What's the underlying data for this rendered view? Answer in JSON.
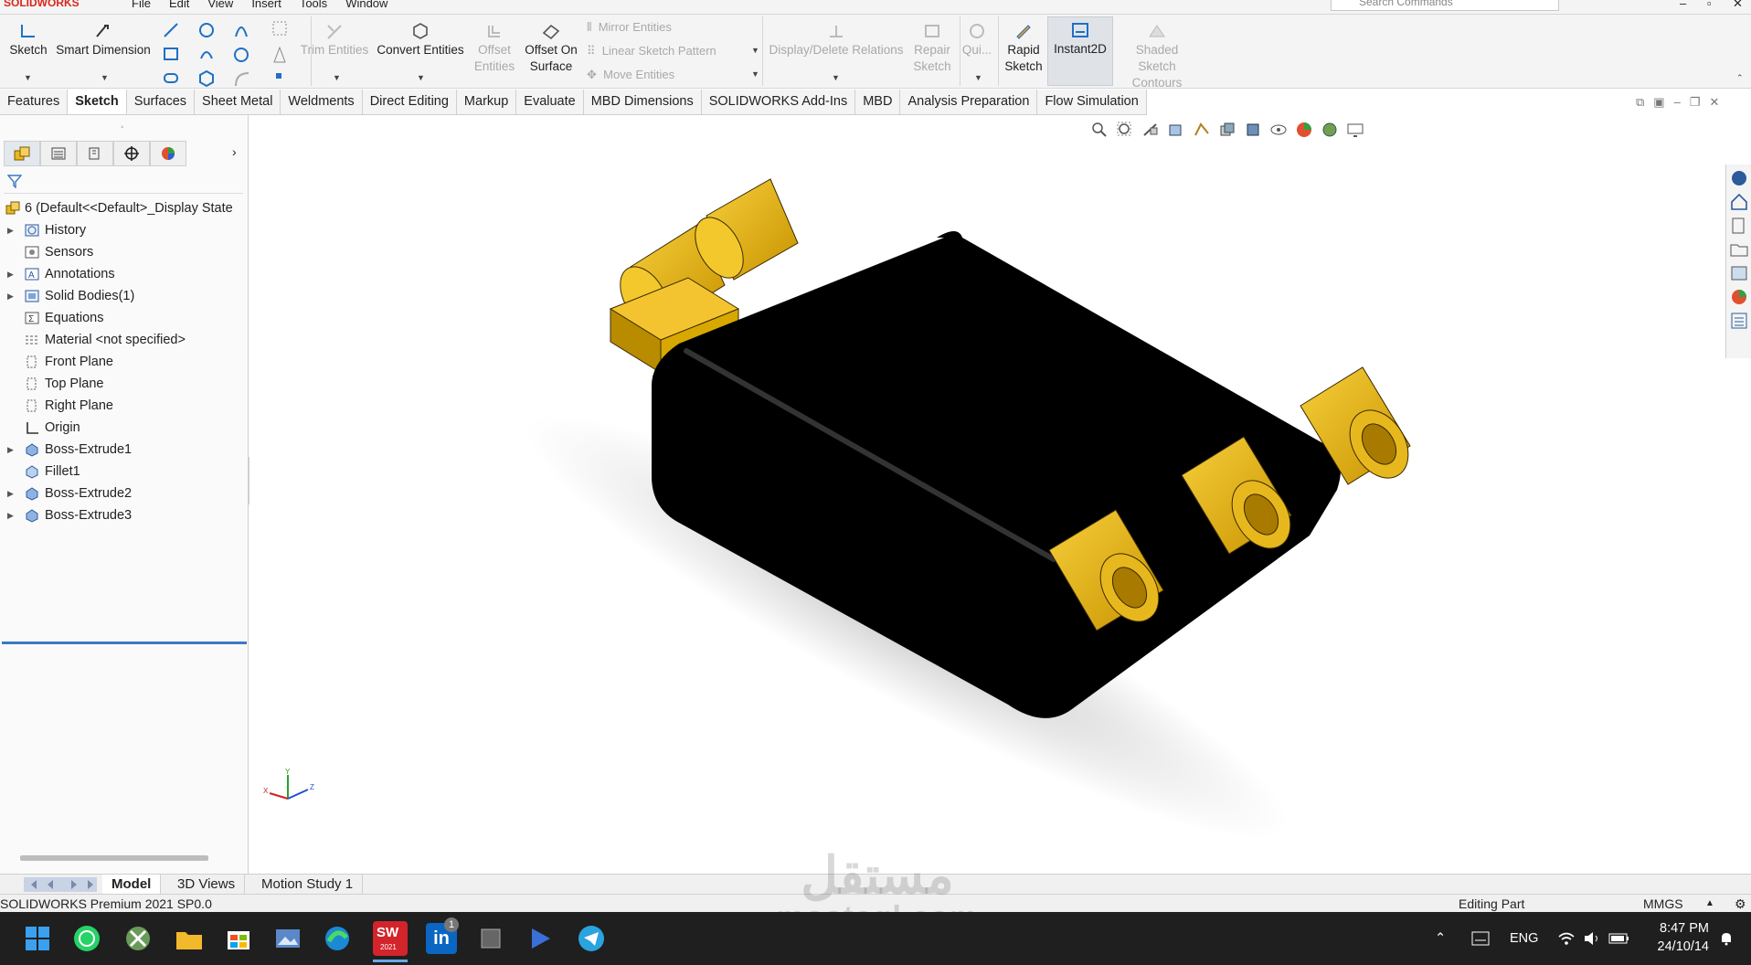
{
  "app": {
    "name": "SOLIDWORKS"
  },
  "menu": [
    "File",
    "Edit",
    "View",
    "Insert",
    "Tools",
    "Window"
  ],
  "search": {
    "placeholder": "Search Commands"
  },
  "ribbon": {
    "sketch": "Sketch",
    "smart_dimension": "Smart Dimension",
    "trim_entities": "Trim Entities",
    "convert_entities": "Convert Entities",
    "offset_entities": "Offset Entities",
    "offset_on_surface": "Offset On Surface",
    "mirror_entities": "Mirror Entities",
    "linear_sketch_pattern": "Linear Sketch Pattern",
    "move_entities": "Move Entities",
    "display_delete_relations": "Display/Delete Relations",
    "repair_sketch": "Repair Sketch",
    "quick_snaps": "Qui...",
    "rapid_sketch": "Rapid Sketch",
    "instant2d": "Instant2D",
    "shaded_sketch_contours": "Shaded Sketch Contours"
  },
  "tabs": [
    "Features",
    "Sketch",
    "Surfaces",
    "Sheet Metal",
    "Weldments",
    "Direct Editing",
    "Markup",
    "Evaluate",
    "MBD Dimensions",
    "SOLIDWORKS Add-Ins",
    "MBD",
    "Analysis Preparation",
    "Flow Simulation"
  ],
  "active_tab": "Sketch",
  "tree": {
    "root": "6  (Default<<Default>_Display State",
    "items": [
      {
        "label": "History",
        "expandable": true,
        "icon": "history-icon"
      },
      {
        "label": "Sensors",
        "expandable": false,
        "icon": "sensors-icon"
      },
      {
        "label": "Annotations",
        "expandable": true,
        "icon": "annotations-icon"
      },
      {
        "label": "Solid Bodies(1)",
        "expandable": true,
        "icon": "solid-bodies-icon"
      },
      {
        "label": "Equations",
        "expandable": false,
        "icon": "equations-icon"
      },
      {
        "label": "Material <not specified>",
        "expandable": false,
        "icon": "material-icon"
      },
      {
        "label": "Front Plane",
        "expandable": false,
        "icon": "plane-icon"
      },
      {
        "label": "Top Plane",
        "expandable": false,
        "icon": "plane-icon"
      },
      {
        "label": "Right Plane",
        "expandable": false,
        "icon": "plane-icon"
      },
      {
        "label": "Origin",
        "expandable": false,
        "icon": "origin-icon"
      },
      {
        "label": "Boss-Extrude1",
        "expandable": true,
        "icon": "extrude-icon"
      },
      {
        "label": "Fillet1",
        "expandable": false,
        "icon": "fillet-icon"
      },
      {
        "label": "Boss-Extrude2",
        "expandable": true,
        "icon": "extrude-icon"
      },
      {
        "label": "Boss-Extrude3",
        "expandable": true,
        "icon": "extrude-icon"
      }
    ]
  },
  "triad": {
    "x": "X",
    "y": "Y",
    "z": "Z"
  },
  "bottom_tabs": [
    "Model",
    "3D Views",
    "Motion Study 1"
  ],
  "status": {
    "version": "SOLIDWORKS Premium 2021 SP0.0",
    "mode": "Editing Part",
    "units": "MMGS"
  },
  "watermark": {
    "arabic": "مستقل",
    "latin": "mostaql.com"
  },
  "taskbar": {
    "sw_badge": "2021",
    "linkedin_badge": "1",
    "lang": "ENG",
    "time": "8:47 PM",
    "date": "24/10/14"
  },
  "colors": {
    "body": "#000000",
    "connector": "#e8b820",
    "selection": "#3b79c4",
    "taskbar": "#1f1f1f"
  }
}
